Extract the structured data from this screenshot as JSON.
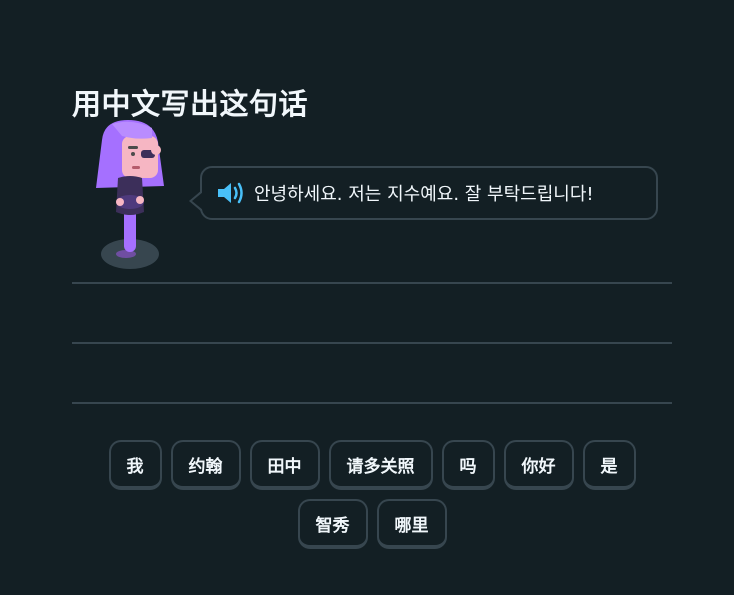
{
  "prompt": {
    "title": "用中文写出这句话"
  },
  "character": {
    "icon": "lily-character-illustration"
  },
  "bubble": {
    "icon": "speaker-icon",
    "sentence": "안녕하세요. 저는 지수예요. 잘 부탁드립니다!"
  },
  "answer_lines_count": 3,
  "word_bank": {
    "row1": [
      "我",
      "约翰",
      "田中",
      "请多关照",
      "吗",
      "你好",
      "是"
    ],
    "row2": [
      "智秀",
      "哪里"
    ]
  },
  "colors": {
    "background": "#131f24",
    "border": "#37464f",
    "text": "#f1f7fb",
    "speaker": "#49c0f8",
    "character_hair": "#a570ff"
  }
}
